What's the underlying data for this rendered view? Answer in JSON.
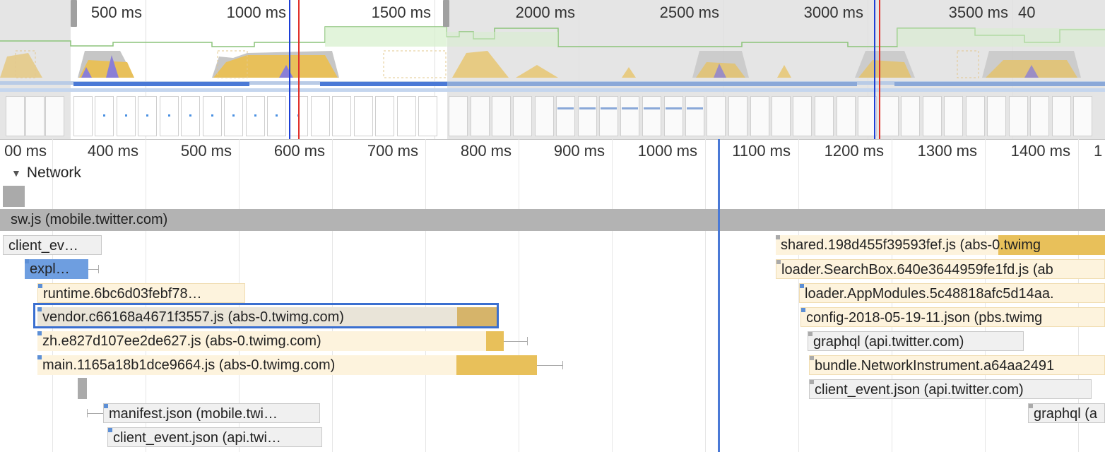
{
  "overview": {
    "ticks": [
      "500 ms",
      "1000 ms",
      "1500 ms",
      "2000 ms",
      "2500 ms",
      "3000 ms",
      "3500 ms",
      "40"
    ]
  },
  "flame": {
    "ticks": [
      "00 ms",
      "400 ms",
      "500 ms",
      "600 ms",
      "700 ms",
      "800 ms",
      "900 ms",
      "1000 ms",
      "1100 ms",
      "1200 ms",
      "1300 ms",
      "1400 ms",
      "1"
    ],
    "section_label": "Network",
    "thread_label": "sw.js (mobile.twitter.com)",
    "requests": {
      "client_ev": "client_ev…",
      "expl": "expl…",
      "runtime": "runtime.6bc6d03febf78…",
      "vendor": "vendor.c66168a4671f3557.js (abs-0.twimg.com)",
      "zh": "zh.e827d107ee2de627.js (abs-0.twimg.com)",
      "main": "main.1165a18b1dce9664.js (abs-0.twimg.com)",
      "manifest": "manifest.json (mobile.twi…",
      "client_event_left": "client_event.json (api.twi…",
      "shared": "shared.198d455f39593fef.js (abs-0.twimg",
      "searchbox": "loader.SearchBox.640e3644959fe1fd.js (ab",
      "appmodules": "loader.AppModules.5c48818afc5d14aa.",
      "config": "config-2018-05-19-11.json (pbs.twimg",
      "graphql1": "graphql (api.twitter.com)",
      "bundle": "bundle.NetworkInstrument.a64aa2491",
      "client_event_right": "client_event.json (api.twitter.com)",
      "graphql2": "graphql (a"
    }
  },
  "colors": {
    "script_fill": "#e8c05a",
    "script_bg": "#fdf3dd",
    "other_bg": "#f0f0f0",
    "selection": "#3a6fd0",
    "marker_blue": "#1c3fd6",
    "marker_red": "#e0302a",
    "cursor_line": "#4a79d6"
  }
}
